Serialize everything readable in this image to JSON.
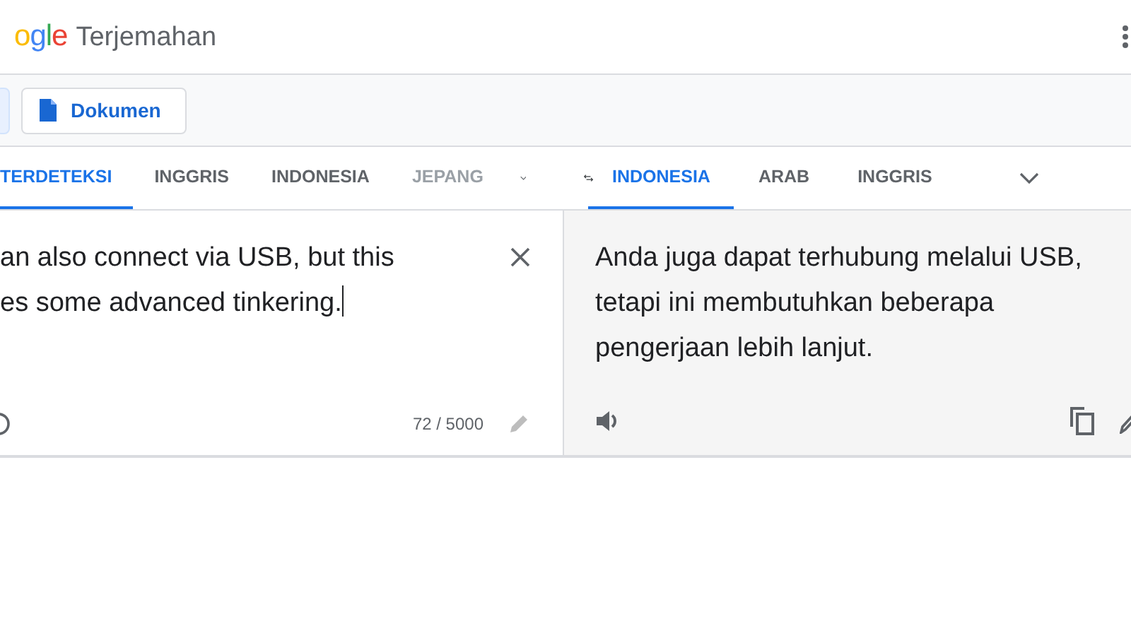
{
  "header": {
    "logo_letters": [
      {
        "text": "o",
        "color": "#fbbc05"
      },
      {
        "text": "g",
        "color": "#4285f4"
      },
      {
        "text": "l",
        "color": "#34a853"
      },
      {
        "text": "e",
        "color": "#ea4335"
      }
    ],
    "title": "Terjemahan"
  },
  "mode_buttons": [
    {
      "selected": true
    },
    {
      "label": "Dokumen",
      "selected": false
    }
  ],
  "source_tabs": [
    {
      "label": "TERDETEKSI",
      "selected": true
    },
    {
      "label": "INGGRIS",
      "selected": false
    },
    {
      "label": "INDONESIA",
      "selected": false
    },
    {
      "label": "JEPANG",
      "selected": false
    }
  ],
  "target_tabs": [
    {
      "label": "INDONESIA",
      "selected": true
    },
    {
      "label": "ARAB",
      "selected": false
    },
    {
      "label": "INGGRIS",
      "selected": false
    }
  ],
  "source": {
    "lines": [
      "an also connect via USB, but this",
      "es some advanced tinkering."
    ],
    "count": "72 / 5000"
  },
  "target": {
    "lines": [
      "Anda juga dapat terhubung melalui USB,",
      "tetapi ini membutuhkan beberapa",
      "pengerjaan lebih lanjut."
    ]
  }
}
